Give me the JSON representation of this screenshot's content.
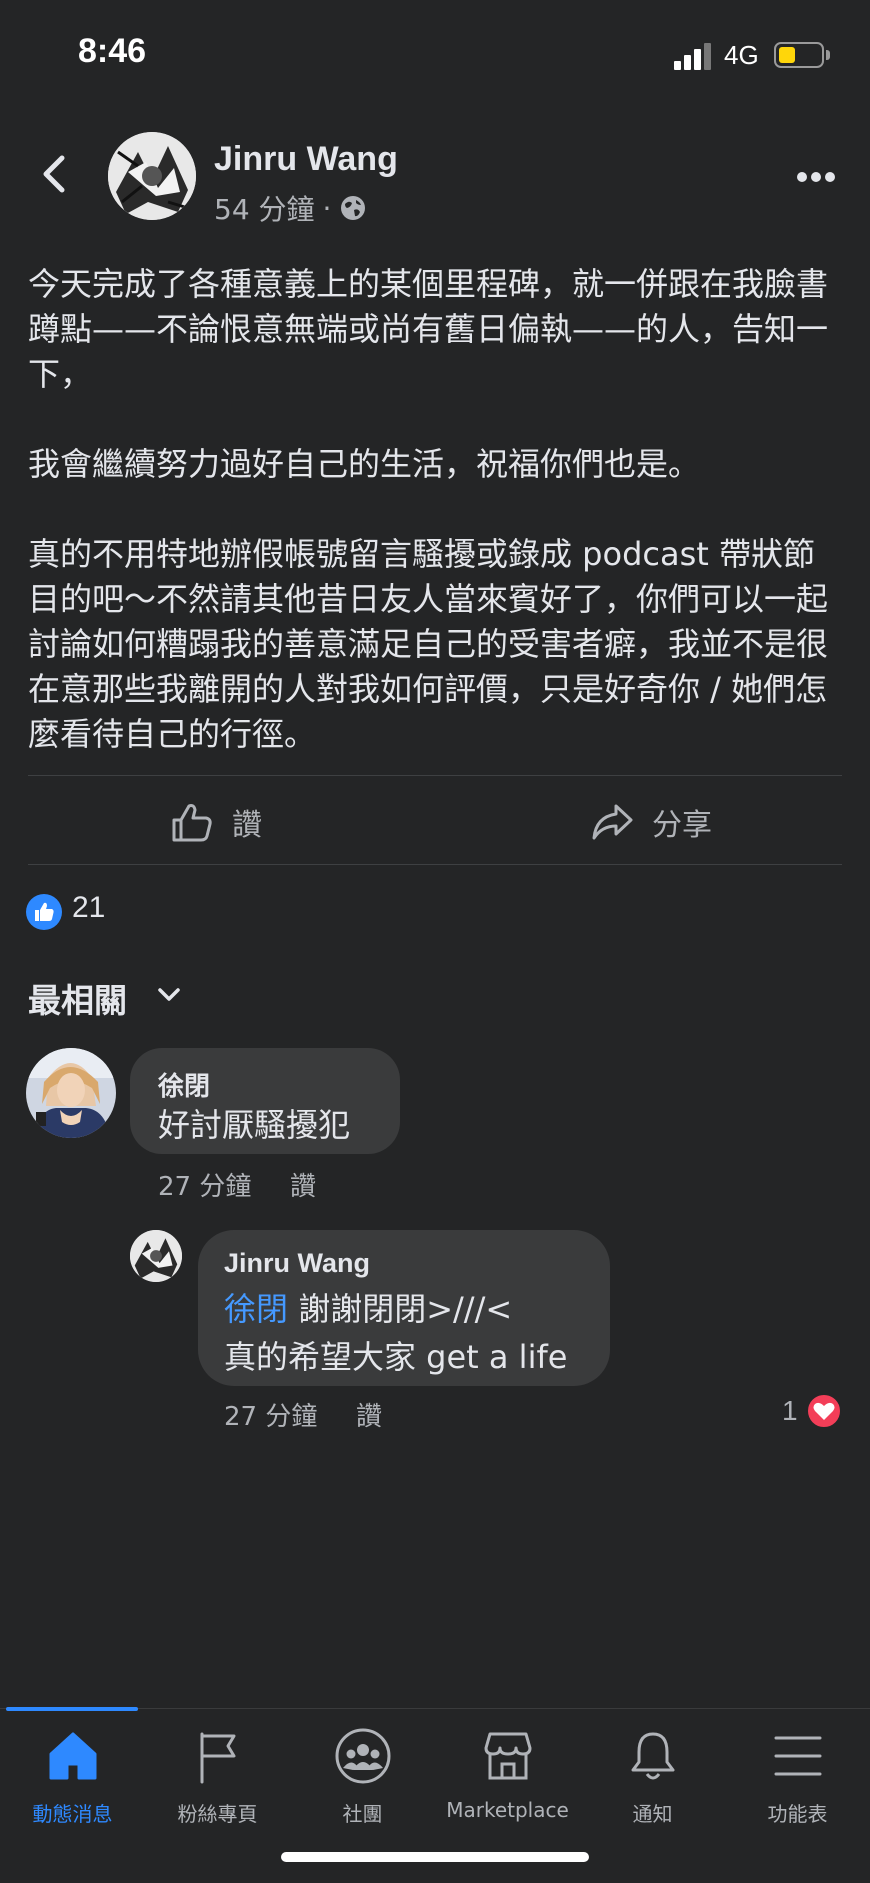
{
  "status_bar": {
    "time": "8:46",
    "network": "4G"
  },
  "post": {
    "author": "Jinru Wang",
    "time": "54 分鐘",
    "separator": "·",
    "paragraphs": [
      "今天完成了各種意義上的某個里程碑，就一併跟在我臉書蹲點——不論恨意無端或尚有舊日偏執——的人，告知一下，",
      "我會繼續努力過好自己的生活，祝福你們也是。",
      "真的不用特地辦假帳號留言騷擾或錄成 podcast 帶狀節目的吧～不然請其他昔日友人當來賓好了，你們可以一起討論如何糟蹋我的善意滿足自己的受害者癖，我並不是很在意那些我離開的人對我如何評價，只是好奇你 / 她們怎麼看待自己的行徑。"
    ],
    "actions": {
      "like": "讚",
      "share": "分享"
    },
    "reaction_count": "21"
  },
  "comments": {
    "sort_label": "最相關",
    "items": [
      {
        "author": "徐閉",
        "text": "好討厭騷擾犯",
        "time": "27 分鐘",
        "like": "讚"
      }
    ],
    "reply": {
      "author": "Jinru Wang",
      "mention": "徐閉",
      "line1_rest": " 謝謝閉閉>///<",
      "line2": "真的希望大家 get a life",
      "time": "27 分鐘",
      "like": "讚",
      "reaction_count": "1"
    }
  },
  "tabs": [
    {
      "label": "動態消息",
      "icon": "home-icon",
      "active": true
    },
    {
      "label": "粉絲專頁",
      "icon": "flag-icon"
    },
    {
      "label": "社團",
      "icon": "groups-icon"
    },
    {
      "label": "Marketplace",
      "icon": "shop-icon"
    },
    {
      "label": "通知",
      "icon": "bell-icon"
    },
    {
      "label": "功能表",
      "icon": "menu-icon"
    }
  ],
  "colors": {
    "background": "#242526",
    "accent": "#2e89ff",
    "bubble": "#3a3b3c",
    "heart": "#f33e58",
    "mention": "#4599ff"
  }
}
